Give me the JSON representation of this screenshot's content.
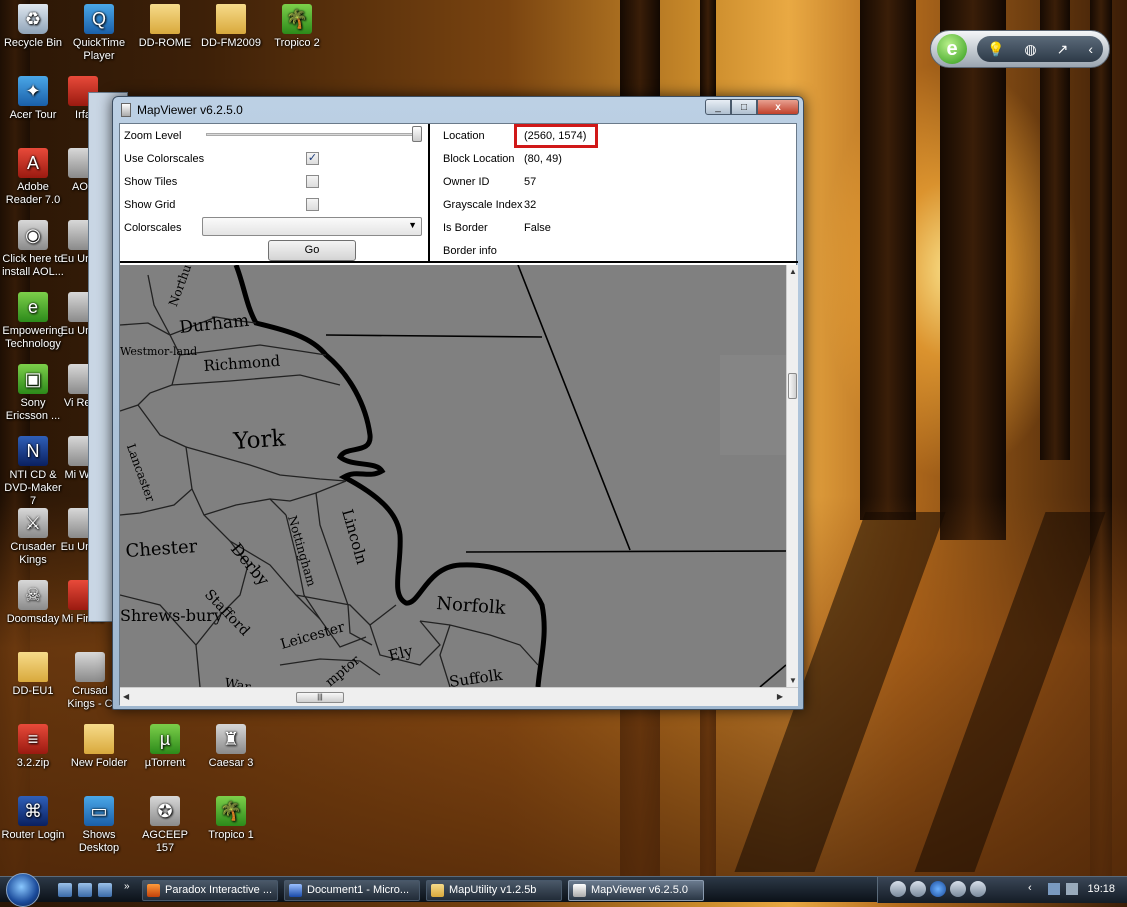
{
  "desktop_icons": [
    {
      "label": "Recycle Bin",
      "icon": "recycle-bin-icon"
    },
    {
      "label": "QuickTime Player",
      "icon": "quicktime-icon"
    },
    {
      "label": "DD-ROME",
      "icon": "folder-icon"
    },
    {
      "label": "DD-FM2009",
      "icon": "folder-icon"
    },
    {
      "label": "Tropico 2",
      "icon": "tropico-icon"
    },
    {
      "label": "Acer Tour",
      "icon": "acer-icon"
    },
    {
      "label": "Adobe Reader 7.0",
      "icon": "adobe-reader-icon"
    },
    {
      "label": "Click here to install AOL...",
      "icon": "aol-icon"
    },
    {
      "label": "Empowering Technology",
      "icon": "empowering-icon"
    },
    {
      "label": "Sony Ericsson ...",
      "icon": "sony-ericsson-icon"
    },
    {
      "label": "NTI CD & DVD-Maker 7",
      "icon": "nti-icon"
    },
    {
      "label": "Crusader Kings",
      "icon": "crusader-kings-icon"
    },
    {
      "label": "Doomsday",
      "icon": "doomsday-icon"
    },
    {
      "label": "DD-EU1",
      "icon": "folder-icon"
    },
    {
      "label": "3.2.zip",
      "icon": "zip-icon"
    },
    {
      "label": "New Folder",
      "icon": "folder-icon"
    },
    {
      "label": "µTorrent",
      "icon": "utorrent-icon"
    },
    {
      "label": "Caesar 3",
      "icon": "caesar-icon"
    },
    {
      "label": "Router Login",
      "icon": "router-icon"
    },
    {
      "label": "Shows Desktop",
      "icon": "show-desktop-icon"
    },
    {
      "label": "AGCEEP 157",
      "icon": "agceep-icon"
    },
    {
      "label": "Tropico 1",
      "icon": "tropico-icon"
    },
    {
      "label": "Irfa",
      "icon": "irfanview-icon"
    },
    {
      "label": "AOL",
      "icon": "aol-icon"
    },
    {
      "label": "Eu Unive",
      "icon": "eu-icon"
    },
    {
      "label": "Eu Unive",
      "icon": "eu-icon"
    },
    {
      "label": "Vi Reve",
      "icon": "vi-icon"
    },
    {
      "label": "Mi Worl",
      "icon": "mi-icon"
    },
    {
      "label": "Eu Unive",
      "icon": "eu-icon"
    },
    {
      "label": "Mi Firefo",
      "icon": "firefox-icon"
    },
    {
      "label": "Crusad Kings - C",
      "icon": "crusader-kings-icon"
    }
  ],
  "window": {
    "title": "MapViewer v6.2.5.0",
    "minimize": "_",
    "maximize": "□",
    "close": "x"
  },
  "controls": {
    "zoom_label": "Zoom Level",
    "zoom_value": 1.0,
    "use_colorscales_label": "Use Colorscales",
    "use_colorscales_checked": true,
    "show_tiles_label": "Show Tiles",
    "show_tiles_checked": false,
    "show_grid_label": "Show Grid",
    "show_grid_checked": false,
    "colorscales_label": "Colorscales",
    "colorscales_value": "",
    "go_label": "Go"
  },
  "info": {
    "location_label": "Location",
    "location_value": "(2560, 1574)",
    "block_location_label": "Block Location",
    "block_location_value": "(80, 49)",
    "owner_id_label": "Owner ID",
    "owner_id_value": "57",
    "grayscale_label": "Grayscale Index",
    "grayscale_value": "32",
    "is_border_label": "Is Border",
    "is_border_value": "False",
    "border_info_label": "Border info",
    "highlight_color": "#d01818"
  },
  "map": {
    "labels": [
      "Northu",
      "Durham",
      "Westmor-land",
      "Richmond",
      "York",
      "Lancaster",
      "Chester",
      "Derby",
      "Nottingham",
      "Lincoln",
      "Norfolk",
      "Shrews-bury",
      "Stafford",
      "Leicester",
      "Ely",
      "Suffolk",
      "mptor",
      "War"
    ],
    "land_color": "#808080",
    "border_color": "#000000"
  },
  "taskbar": {
    "buttons": [
      "Paradox Interactive ...",
      "Document1 - Micro...",
      "MapUtility v1.2.5b",
      "MapViewer v6.2.5.0"
    ],
    "active_index": 3,
    "clock": "19:18"
  }
}
